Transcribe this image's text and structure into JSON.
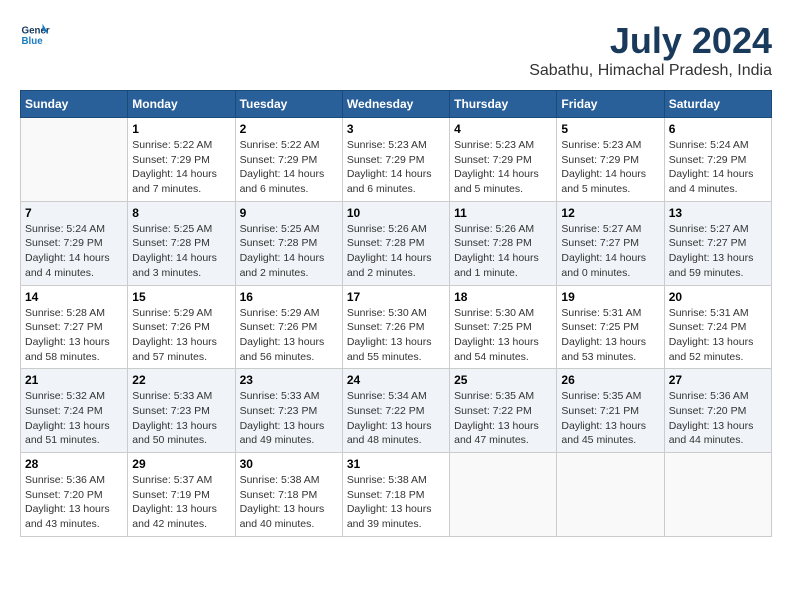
{
  "logo": {
    "line1": "General",
    "line2": "Blue"
  },
  "title": "July 2024",
  "location": "Sabathu, Himachal Pradesh, India",
  "weekdays": [
    "Sunday",
    "Monday",
    "Tuesday",
    "Wednesday",
    "Thursday",
    "Friday",
    "Saturday"
  ],
  "weeks": [
    [
      {
        "day": "",
        "info": ""
      },
      {
        "day": "1",
        "info": "Sunrise: 5:22 AM\nSunset: 7:29 PM\nDaylight: 14 hours\nand 7 minutes."
      },
      {
        "day": "2",
        "info": "Sunrise: 5:22 AM\nSunset: 7:29 PM\nDaylight: 14 hours\nand 6 minutes."
      },
      {
        "day": "3",
        "info": "Sunrise: 5:23 AM\nSunset: 7:29 PM\nDaylight: 14 hours\nand 6 minutes."
      },
      {
        "day": "4",
        "info": "Sunrise: 5:23 AM\nSunset: 7:29 PM\nDaylight: 14 hours\nand 5 minutes."
      },
      {
        "day": "5",
        "info": "Sunrise: 5:23 AM\nSunset: 7:29 PM\nDaylight: 14 hours\nand 5 minutes."
      },
      {
        "day": "6",
        "info": "Sunrise: 5:24 AM\nSunset: 7:29 PM\nDaylight: 14 hours\nand 4 minutes."
      }
    ],
    [
      {
        "day": "7",
        "info": "Sunrise: 5:24 AM\nSunset: 7:29 PM\nDaylight: 14 hours\nand 4 minutes."
      },
      {
        "day": "8",
        "info": "Sunrise: 5:25 AM\nSunset: 7:28 PM\nDaylight: 14 hours\nand 3 minutes."
      },
      {
        "day": "9",
        "info": "Sunrise: 5:25 AM\nSunset: 7:28 PM\nDaylight: 14 hours\nand 2 minutes."
      },
      {
        "day": "10",
        "info": "Sunrise: 5:26 AM\nSunset: 7:28 PM\nDaylight: 14 hours\nand 2 minutes."
      },
      {
        "day": "11",
        "info": "Sunrise: 5:26 AM\nSunset: 7:28 PM\nDaylight: 14 hours\nand 1 minute."
      },
      {
        "day": "12",
        "info": "Sunrise: 5:27 AM\nSunset: 7:27 PM\nDaylight: 14 hours\nand 0 minutes."
      },
      {
        "day": "13",
        "info": "Sunrise: 5:27 AM\nSunset: 7:27 PM\nDaylight: 13 hours\nand 59 minutes."
      }
    ],
    [
      {
        "day": "14",
        "info": "Sunrise: 5:28 AM\nSunset: 7:27 PM\nDaylight: 13 hours\nand 58 minutes."
      },
      {
        "day": "15",
        "info": "Sunrise: 5:29 AM\nSunset: 7:26 PM\nDaylight: 13 hours\nand 57 minutes."
      },
      {
        "day": "16",
        "info": "Sunrise: 5:29 AM\nSunset: 7:26 PM\nDaylight: 13 hours\nand 56 minutes."
      },
      {
        "day": "17",
        "info": "Sunrise: 5:30 AM\nSunset: 7:26 PM\nDaylight: 13 hours\nand 55 minutes."
      },
      {
        "day": "18",
        "info": "Sunrise: 5:30 AM\nSunset: 7:25 PM\nDaylight: 13 hours\nand 54 minutes."
      },
      {
        "day": "19",
        "info": "Sunrise: 5:31 AM\nSunset: 7:25 PM\nDaylight: 13 hours\nand 53 minutes."
      },
      {
        "day": "20",
        "info": "Sunrise: 5:31 AM\nSunset: 7:24 PM\nDaylight: 13 hours\nand 52 minutes."
      }
    ],
    [
      {
        "day": "21",
        "info": "Sunrise: 5:32 AM\nSunset: 7:24 PM\nDaylight: 13 hours\nand 51 minutes."
      },
      {
        "day": "22",
        "info": "Sunrise: 5:33 AM\nSunset: 7:23 PM\nDaylight: 13 hours\nand 50 minutes."
      },
      {
        "day": "23",
        "info": "Sunrise: 5:33 AM\nSunset: 7:23 PM\nDaylight: 13 hours\nand 49 minutes."
      },
      {
        "day": "24",
        "info": "Sunrise: 5:34 AM\nSunset: 7:22 PM\nDaylight: 13 hours\nand 48 minutes."
      },
      {
        "day": "25",
        "info": "Sunrise: 5:35 AM\nSunset: 7:22 PM\nDaylight: 13 hours\nand 47 minutes."
      },
      {
        "day": "26",
        "info": "Sunrise: 5:35 AM\nSunset: 7:21 PM\nDaylight: 13 hours\nand 45 minutes."
      },
      {
        "day": "27",
        "info": "Sunrise: 5:36 AM\nSunset: 7:20 PM\nDaylight: 13 hours\nand 44 minutes."
      }
    ],
    [
      {
        "day": "28",
        "info": "Sunrise: 5:36 AM\nSunset: 7:20 PM\nDaylight: 13 hours\nand 43 minutes."
      },
      {
        "day": "29",
        "info": "Sunrise: 5:37 AM\nSunset: 7:19 PM\nDaylight: 13 hours\nand 42 minutes."
      },
      {
        "day": "30",
        "info": "Sunrise: 5:38 AM\nSunset: 7:18 PM\nDaylight: 13 hours\nand 40 minutes."
      },
      {
        "day": "31",
        "info": "Sunrise: 5:38 AM\nSunset: 7:18 PM\nDaylight: 13 hours\nand 39 minutes."
      },
      {
        "day": "",
        "info": ""
      },
      {
        "day": "",
        "info": ""
      },
      {
        "day": "",
        "info": ""
      }
    ]
  ]
}
